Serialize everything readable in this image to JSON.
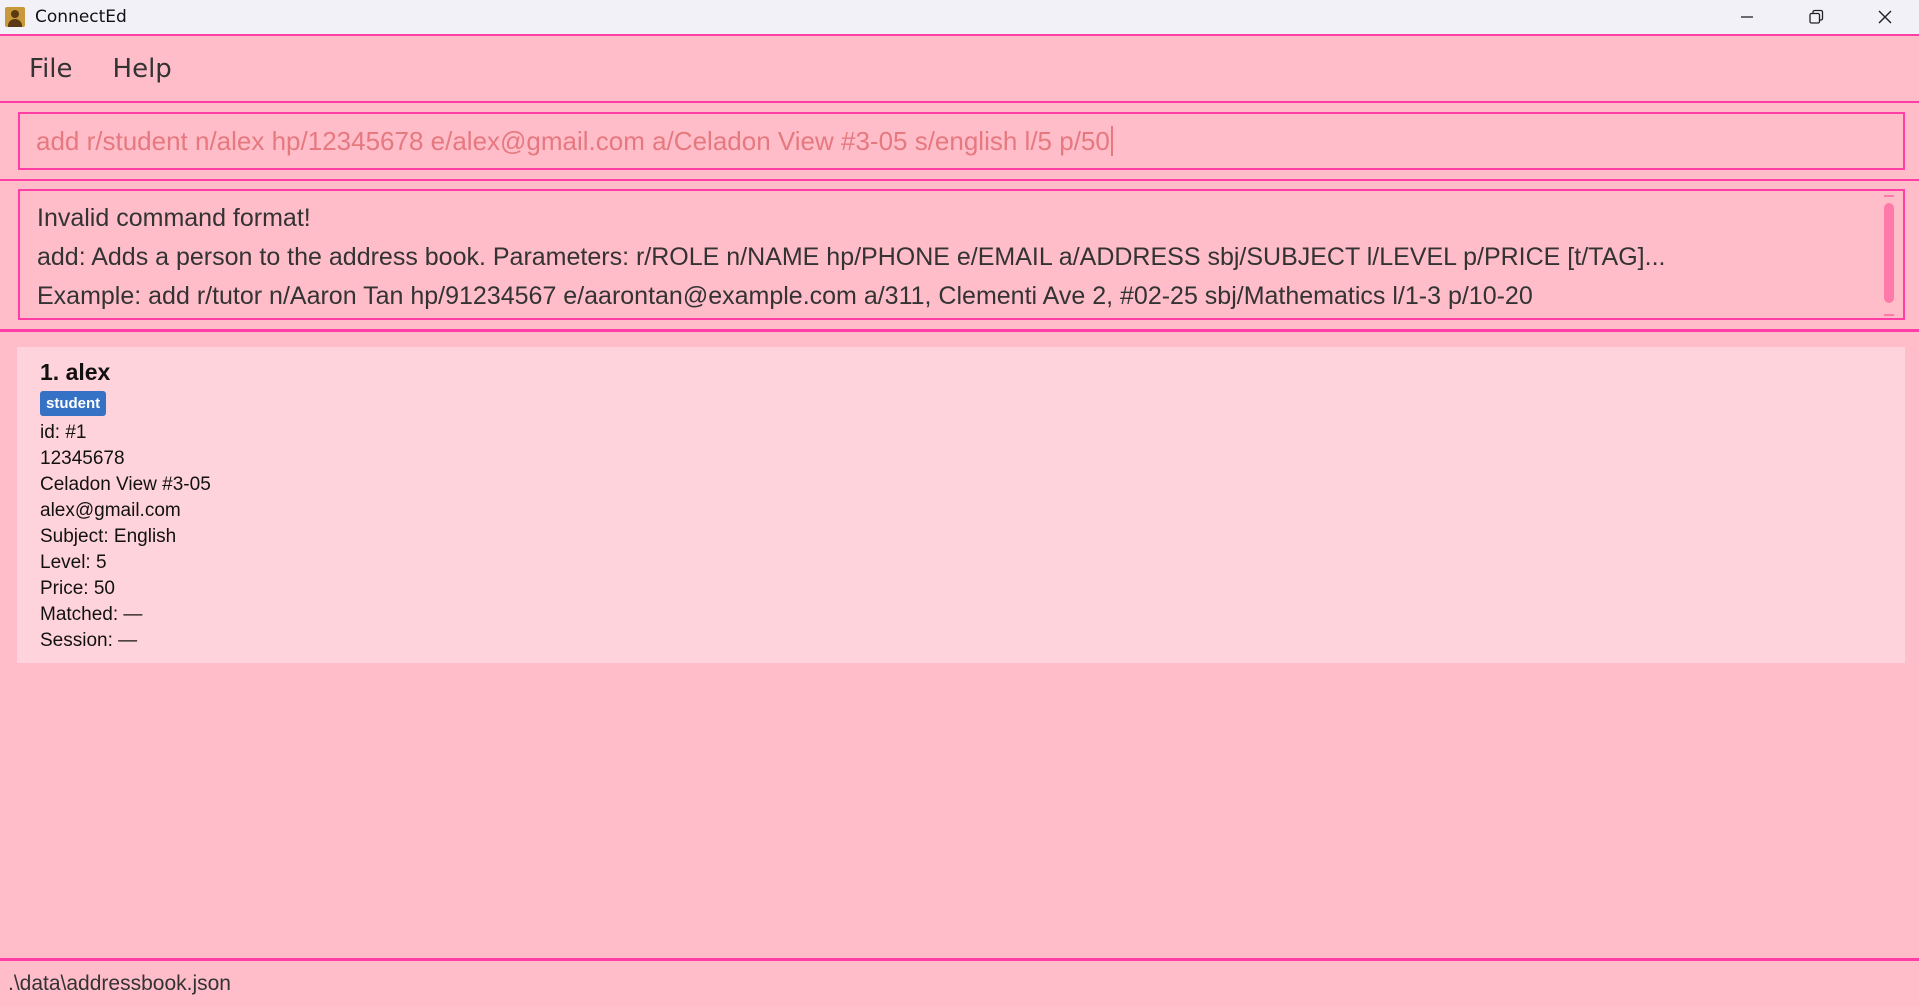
{
  "window": {
    "title": "ConnectEd",
    "app_icon": "app-icon",
    "controls": {
      "minimize": "minimize-icon",
      "restore": "restore-icon",
      "close": "close-icon"
    }
  },
  "menu": {
    "items": [
      {
        "label": "File"
      },
      {
        "label": "Help"
      }
    ]
  },
  "command": {
    "value": "add r/student n/alex hp/12345678 e/alex@gmail.com a/Celadon View #3-05 s/english l/5 p/50"
  },
  "result": {
    "lines": [
      "Invalid command format!",
      "add: Adds a person to the address book. Parameters: r/ROLE n/NAME hp/PHONE e/EMAIL a/ADDRESS sbj/SUBJECT l/LEVEL p/PRICE [t/TAG]...",
      "Example: add r/tutor n/Aaron Tan hp/91234567 e/aarontan@example.com a/311, Clementi Ave 2, #02-25 sbj/Mathematics l/1-3 p/10-20"
    ]
  },
  "persons": [
    {
      "name": "1. alex",
      "tag": "student",
      "id": "id: #1",
      "phone": "12345678",
      "address": "Celadon View #3-05",
      "email": "alex@gmail.com",
      "subject": "Subject: English",
      "level": "Level: 5",
      "price": "Price: 50",
      "matched": "Matched: —",
      "session": "Session: —"
    }
  ],
  "status": {
    "file_path": ".\\data\\addressbook.json"
  },
  "colors": {
    "background": "#ffbdc9",
    "border": "#ff3fa5",
    "card": "#ffd3dc",
    "tag": "#3572c6",
    "command_text": "#e5797f"
  }
}
